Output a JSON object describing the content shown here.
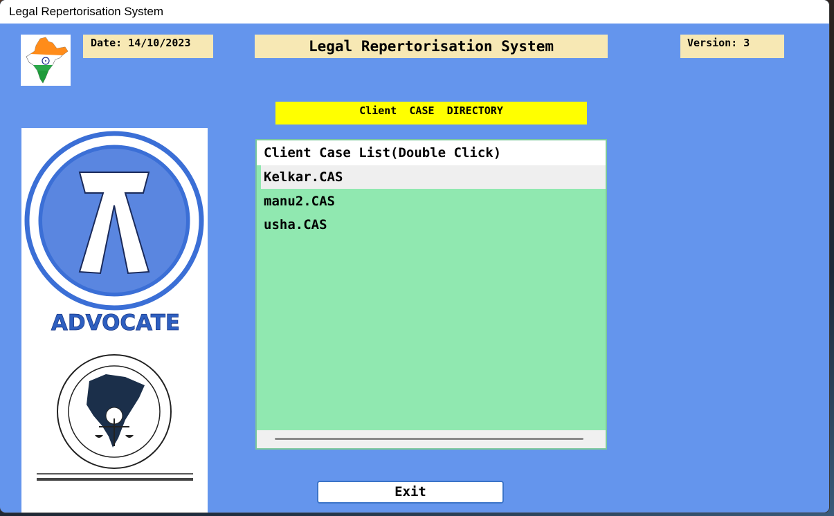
{
  "window": {
    "title": "Legal Repertorisation System"
  },
  "header": {
    "date": "Date: 14/10/2023",
    "app_title": "Legal Repertorisation System",
    "version": "Version: 3"
  },
  "directory_label": "Client  CASE  DIRECTORY",
  "list": {
    "header": "Client Case List(Double Click)",
    "items": [
      "Kelkar.CAS",
      "manu2.CAS",
      "usha.CAS"
    ],
    "selected_index": 0
  },
  "logos": {
    "flag_icon": "india-map-flag-icon",
    "advocate_text": "ADVOCATE",
    "advocate_icon": "advocate-emblem-icon",
    "association_icon": "legal-association-seal-icon"
  },
  "buttons": {
    "exit": "Exit"
  },
  "colors": {
    "background": "#6495ed",
    "tan": "#f7e8b4",
    "yellow": "#ffff00",
    "list_green": "#90e8b0",
    "advocate_blue": "#3b6fd6"
  }
}
